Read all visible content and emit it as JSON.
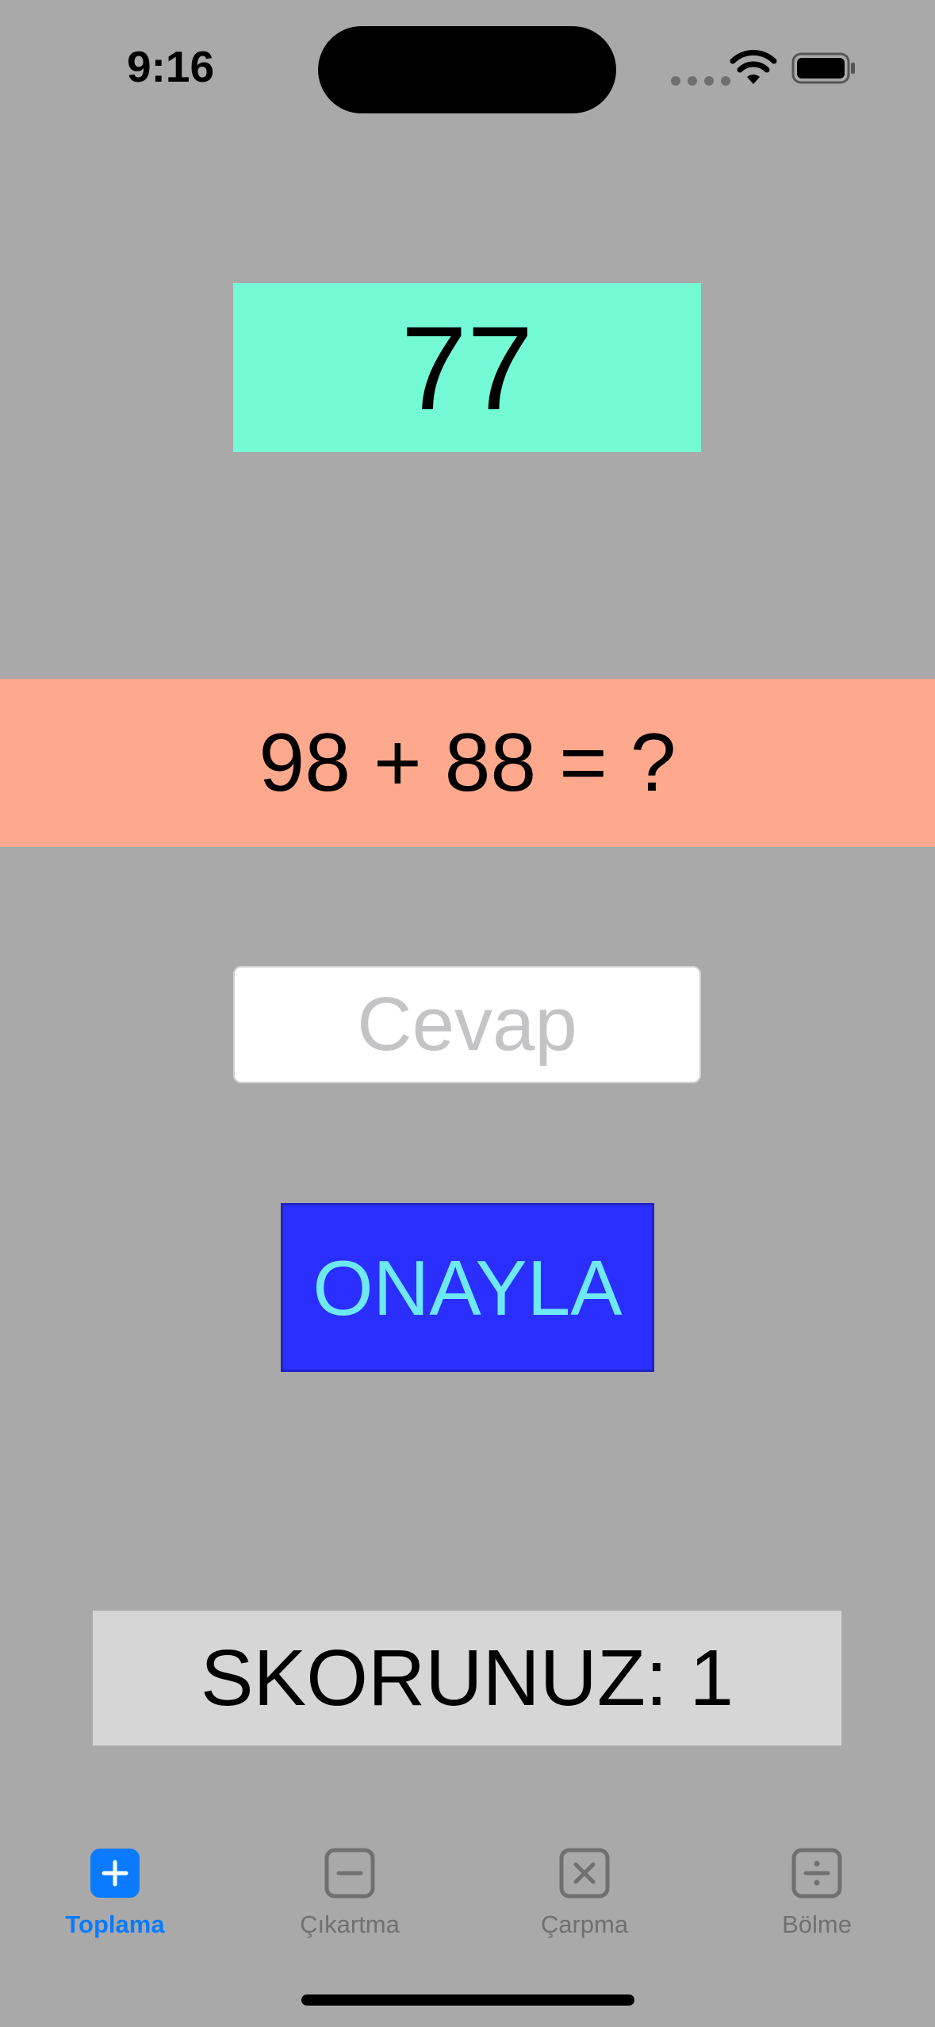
{
  "status_bar": {
    "time": "9:16"
  },
  "timer": {
    "value": "77"
  },
  "question": {
    "text": "98 + 88 = ?"
  },
  "answer": {
    "placeholder": "Cevap",
    "value": ""
  },
  "confirm": {
    "label": "ONAYLA"
  },
  "score": {
    "text": "SKORUNUZ: 1"
  },
  "tabs": [
    {
      "label": "Toplama",
      "icon": "plus-square-icon",
      "active": true
    },
    {
      "label": "Çıkartma",
      "icon": "minus-square-icon",
      "active": false
    },
    {
      "label": "Çarpma",
      "icon": "multiply-square-icon",
      "active": false
    },
    {
      "label": "Bölme",
      "icon": "divide-square-icon",
      "active": false
    }
  ],
  "colors": {
    "background": "#a9a9a9",
    "timer_bg": "#74fbd6",
    "question_bg": "#fea98e",
    "confirm_bg": "#2a2fff",
    "confirm_text": "#6ee9f3",
    "score_bg": "#d6d6d6",
    "tab_active": "#0a7bff",
    "tab_inactive": "#707070"
  }
}
